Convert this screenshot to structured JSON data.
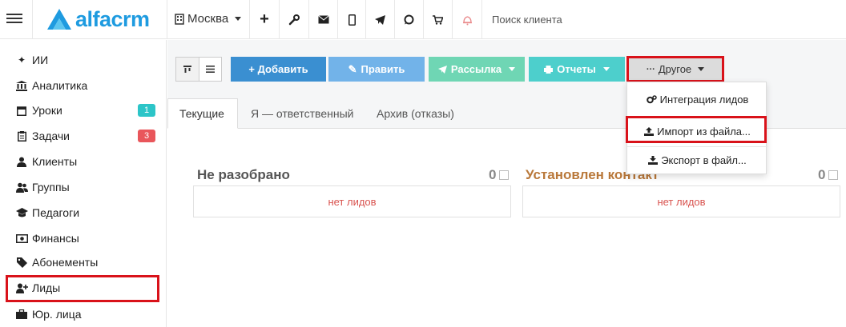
{
  "app": {
    "logo_text": "alfacrm",
    "accent_color": "#1e9be0"
  },
  "topbar": {
    "city": "Москва",
    "icons": [
      "plus-icon",
      "wrench-icon",
      "envelope-icon",
      "mobile-icon",
      "telegram-icon",
      "whatsapp-icon",
      "cart-icon",
      "bell-icon"
    ],
    "search_placeholder": "Поиск клиента"
  },
  "sidebar": {
    "items": [
      {
        "label": "ИИ",
        "icon": "sparkle-icon"
      },
      {
        "label": "Аналитика",
        "icon": "bank-icon"
      },
      {
        "label": "Уроки",
        "icon": "calendar-icon",
        "badge": "1",
        "badge_color": "#2cc5c8"
      },
      {
        "label": "Задачи",
        "icon": "clipboard-icon",
        "badge": "3",
        "badge_color": "#e9565b"
      },
      {
        "label": "Клиенты",
        "icon": "user-icon"
      },
      {
        "label": "Группы",
        "icon": "users-icon"
      },
      {
        "label": "Педагоги",
        "icon": "graduation-cap-icon"
      },
      {
        "label": "Финансы",
        "icon": "money-icon"
      },
      {
        "label": "Абонементы",
        "icon": "tag-icon"
      },
      {
        "label": "Лиды",
        "icon": "user-plus-icon"
      },
      {
        "label": "Юр. лица",
        "icon": "briefcase-icon"
      }
    ]
  },
  "toolbar": {
    "add": "+ Добавить",
    "edit": "Править",
    "mailing": "Рассылка",
    "reports": "Отчеты",
    "other": "Другое",
    "colors": {
      "add": "#3a8fd1",
      "edit": "#72b3e9",
      "mailing": "#6fd6b4",
      "reports": "#4dcfcc",
      "other": "#dcdcdc"
    }
  },
  "tabs": [
    "Текущие",
    "Я — ответственный",
    "Архив (отказы)"
  ],
  "columns": [
    {
      "title": "Не разобрано",
      "count": "0",
      "empty": "нет лидов",
      "title_color": "#555555"
    },
    {
      "title": "Установлен контакт",
      "count": "0",
      "empty": "нет лидов",
      "title_color": "#b9783a"
    }
  ],
  "dropdown": {
    "items": [
      {
        "label": "Интеграция лидов",
        "icon": "cogs-icon"
      },
      {
        "label": "Импорт из файла...",
        "icon": "upload-icon"
      },
      {
        "label": "Экспорт в файл...",
        "icon": "download-icon"
      }
    ]
  }
}
